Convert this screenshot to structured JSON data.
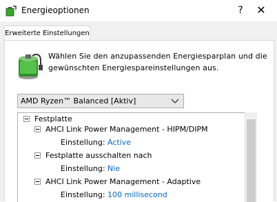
{
  "window": {
    "title": "Energieoptionen",
    "help_label": "?",
    "close_label": "✕"
  },
  "tab": {
    "label": "Erweiterte Einstellungen"
  },
  "intro": {
    "text": "Wählen Sie den anzupassenden Energiesparplan und die gewünschten Energiespareinstellungen aus."
  },
  "plan_select": {
    "value": "AMD Ryzen™ Balanced [Aktiv]"
  },
  "tree": {
    "category": "Festplatte",
    "items": [
      {
        "label": "AHCI Link Power Management - HIPM/DIPM",
        "setting_label": "Einstellung:",
        "value": "Active"
      },
      {
        "label": "Festplatte ausschalten nach",
        "setting_label": "Einstellung:",
        "value": "Nie"
      },
      {
        "label": "AHCI Link Power Management - Adaptive",
        "setting_label": "Einstellung:",
        "value": "100 millisecond"
      }
    ]
  },
  "colors": {
    "value_link": "#0066cc",
    "dialog_bg": "#f0f0f0"
  }
}
